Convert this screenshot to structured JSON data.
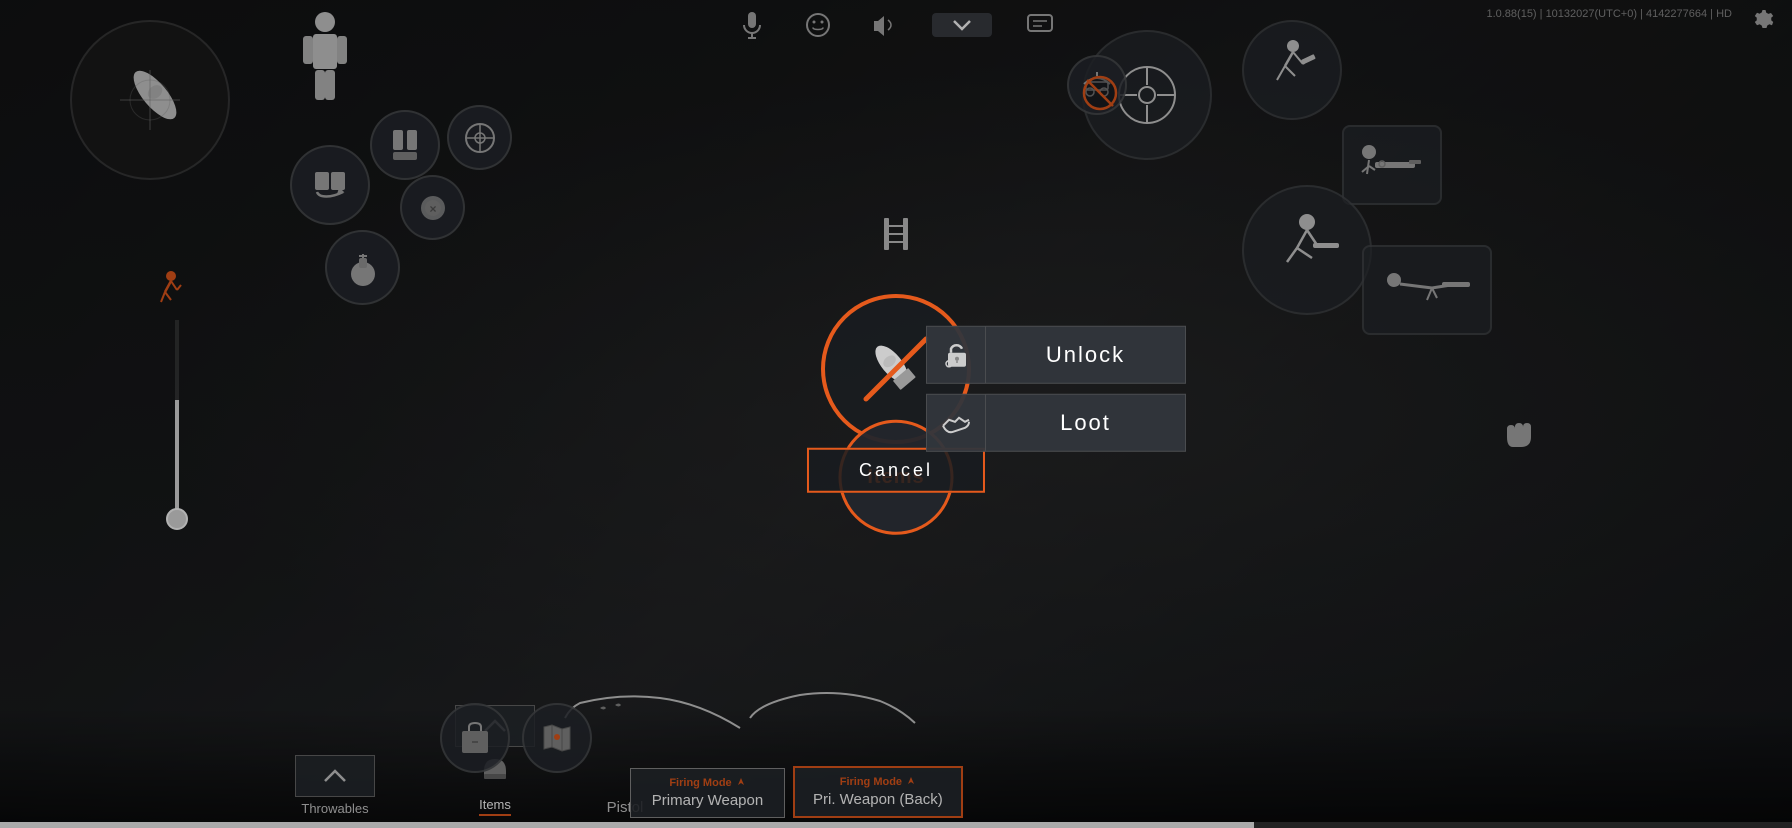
{
  "version": {
    "text": "1.0.88(15) | 10132027(UTC+0) | 4142277664 | HD"
  },
  "topbar": {
    "mic_icon": "🎤",
    "emoji_icon": "😊",
    "volume_icon": "🔊",
    "chat_icon": "💬",
    "dropdown_icon": "▼",
    "settings_icon": "⚙"
  },
  "center_wheel": {
    "bullet_label": "",
    "items_label": "Items",
    "cancel_label": "Cancel",
    "unlock_label": "Unlock",
    "loot_label": "Loot",
    "ladder_icon": "⊞"
  },
  "action_icons": {
    "unlock_icon": "🔒",
    "loot_icon": "🤝"
  },
  "bottom_nav": {
    "throwables_label": "Throwables",
    "items_label": "Items",
    "pistol_label": "Pistol",
    "primary_weapon_label": "Primary Weapon",
    "pri_weapon_back_label": "Pri. Weapon (Back)"
  },
  "firing_modes": {
    "label": "Firing Mode",
    "icon": "🔥",
    "pistol_mode": "Firing Mode",
    "primary_mode": "Firing Mode"
  },
  "health": {
    "fill_percent": 60
  },
  "colors": {
    "orange": "#e55a1c",
    "dark_bg": "#1a1e22",
    "panel_bg": "rgba(50,54,60,0.95)",
    "border": "rgba(100,100,100,0.5)"
  }
}
